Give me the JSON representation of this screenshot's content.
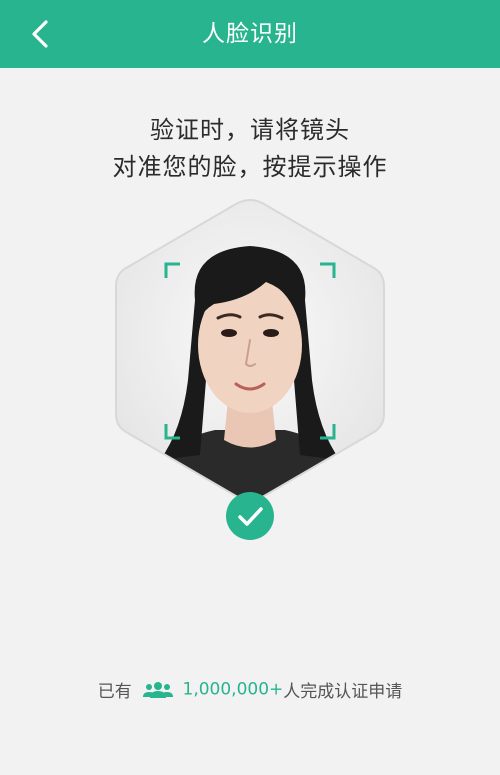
{
  "header": {
    "title": "人脸识别",
    "back_icon": "chevron-left-icon"
  },
  "instruction": {
    "line1": "验证时，请将镜头",
    "line2": "对准您的脸，按提示操作"
  },
  "status": {
    "success_icon": "checkmark-icon"
  },
  "footer": {
    "prefix": "已有",
    "icon": "users-icon",
    "count": "1,000,000+",
    "suffix": "人完成认证申请"
  },
  "colors": {
    "accent": "#27b48f",
    "background": "#f2f2f2",
    "text": "#2b2b2b"
  }
}
